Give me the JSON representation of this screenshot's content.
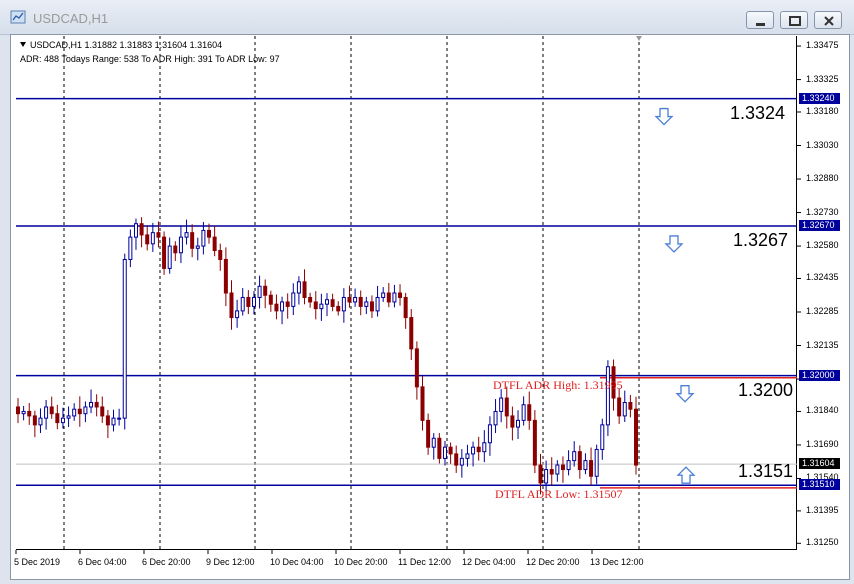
{
  "window": {
    "title": "USDCAD,H1"
  },
  "chart_data": {
    "type": "candlestick",
    "symbol": "USDCAD,H1",
    "ohlc_header": "USDCAD,H1  1.31882 1.31883 1.31604 1.31604",
    "adr_header": "ADR: 488  Todays Range: 538  To ADR High: 391  To ADR Low: 97",
    "ylim": [
      1.3122,
      1.3352
    ],
    "y_ticks": [
      "1.33475",
      "1.33325",
      "1.33180",
      "1.33030",
      "1.32880",
      "1.32730",
      "1.32580",
      "1.32435",
      "1.32285",
      "1.32135",
      "1.31985",
      "1.31840",
      "1.31690",
      "1.31540",
      "1.31395",
      "1.31250"
    ],
    "x_ticks": [
      "5 Dec 2019",
      "6 Dec 04:00",
      "6 Dec 20:00",
      "9 Dec 12:00",
      "10 Dec 04:00",
      "10 Dec 20:00",
      "11 Dec 12:00",
      "12 Dec 04:00",
      "12 Dec 20:00",
      "13 Dec 12:00"
    ],
    "close_path": [
      1.3183,
      1.3184,
      1.3182,
      1.3178,
      1.3181,
      1.3186,
      1.3183,
      1.3179,
      1.3181,
      1.3182,
      1.3185,
      1.3183,
      1.3186,
      1.3188,
      1.3186,
      1.3182,
      1.3178,
      1.3181,
      1.3181,
      1.3252,
      1.3262,
      1.3268,
      1.3263,
      1.3259,
      1.3264,
      1.3262,
      1.3248,
      1.3258,
      1.3255,
      1.3262,
      1.3264,
      1.3257,
      1.3258,
      1.3265,
      1.3262,
      1.3256,
      1.3252,
      1.3237,
      1.3226,
      1.3229,
      1.3235,
      1.3231,
      1.3235,
      1.324,
      1.3236,
      1.3232,
      1.3229,
      1.3233,
      1.3231,
      1.3237,
      1.3242,
      1.3235,
      1.3233,
      1.323,
      1.3232,
      1.3234,
      1.3231,
      1.3229,
      1.3235,
      1.3233,
      1.3235,
      1.3231,
      1.3233,
      1.3229,
      1.3235,
      1.3237,
      1.3233,
      1.3237,
      1.3235,
      1.3226,
      1.3212,
      1.3195,
      1.318,
      1.3168,
      1.3172,
      1.3163,
      1.3168,
      1.3165,
      1.316,
      1.3163,
      1.3165,
      1.3168,
      1.3166,
      1.317,
      1.3178,
      1.3184,
      1.319,
      1.3182,
      1.3177,
      1.318,
      1.3187,
      1.318,
      1.316,
      1.3152,
      1.3158,
      1.3156,
      1.316,
      1.3158,
      1.3162,
      1.3166,
      1.3158,
      1.3162,
      1.3155,
      1.3167,
      1.3178,
      1.3204,
      1.319,
      1.3182,
      1.3188,
      1.3185,
      1.316
    ],
    "levels": [
      {
        "value": 1.3324,
        "tag": "1.33240",
        "label": "1.3324",
        "color": "#00009c",
        "arrow": "down"
      },
      {
        "value": 1.3267,
        "tag": "1.32670",
        "label": "1.3267",
        "color": "#00009c",
        "arrow": "down"
      },
      {
        "value": 1.32,
        "tag": "1.32000",
        "label": "1.3200",
        "color": "#00009c",
        "arrow": "down"
      },
      {
        "value": 1.3151,
        "tag": "1.31510",
        "label": "1.3151",
        "color": "#00009c",
        "arrow": "up"
      }
    ],
    "adr_high": {
      "value": 1.31995,
      "text": "DTFL ADR High: 1.31995",
      "color": "#e02020"
    },
    "adr_low": {
      "value": 1.31507,
      "text": "DTFL ADR Low: 1.31507",
      "color": "#e02020"
    },
    "bid": {
      "value": 1.31604,
      "tag": "1.31604"
    },
    "colors": {
      "up": "#00009c",
      "down": "#8b0000",
      "grid": "#000000",
      "arrow": "#4a7fd6"
    }
  }
}
